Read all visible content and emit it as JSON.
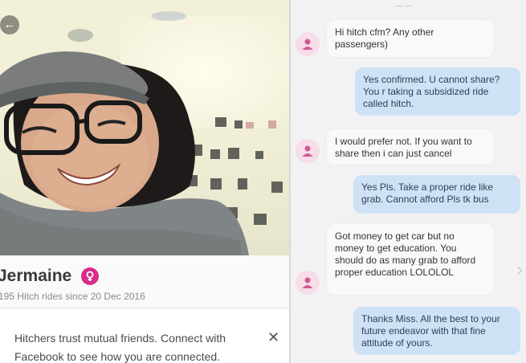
{
  "profile": {
    "name": "Jermaine",
    "stats": "195 Hitch rides since 20 Dec 2016",
    "back_icon": "arrow-left-icon",
    "gender_icon": "female-icon"
  },
  "facebook_banner": {
    "text": "Hitchers trust mutual friends. Connect with Facebook to see how you are connected.",
    "close_label": "✕"
  },
  "chat": {
    "messages": [
      {
        "from": "other",
        "text": "Hi hitch cfm? Any other passengers)"
      },
      {
        "from": "me",
        "text": "Yes confirmed. U cannot share? You r taking a subsidized ride called hitch."
      },
      {
        "from": "other",
        "text": "I would prefer not. If you want to share then i can just cancel"
      },
      {
        "from": "me",
        "text": "Yes Pls. Take a proper ride like grab. Cannot afford Pls tk bus"
      },
      {
        "from": "other",
        "text": "Got money to get car but no money to get education. You should do as many grab to afford proper education LOLOLOL"
      },
      {
        "from": "me",
        "text": "Thanks Miss. All the best to your future endeavor with that fine attitude of yours."
      }
    ]
  },
  "colors": {
    "gender_badge": "#d72d8a",
    "outgoing_bubble": "#cfe2f5",
    "incoming_bubble": "#f9f9fb",
    "avatar_bg": "#f6dde8"
  }
}
